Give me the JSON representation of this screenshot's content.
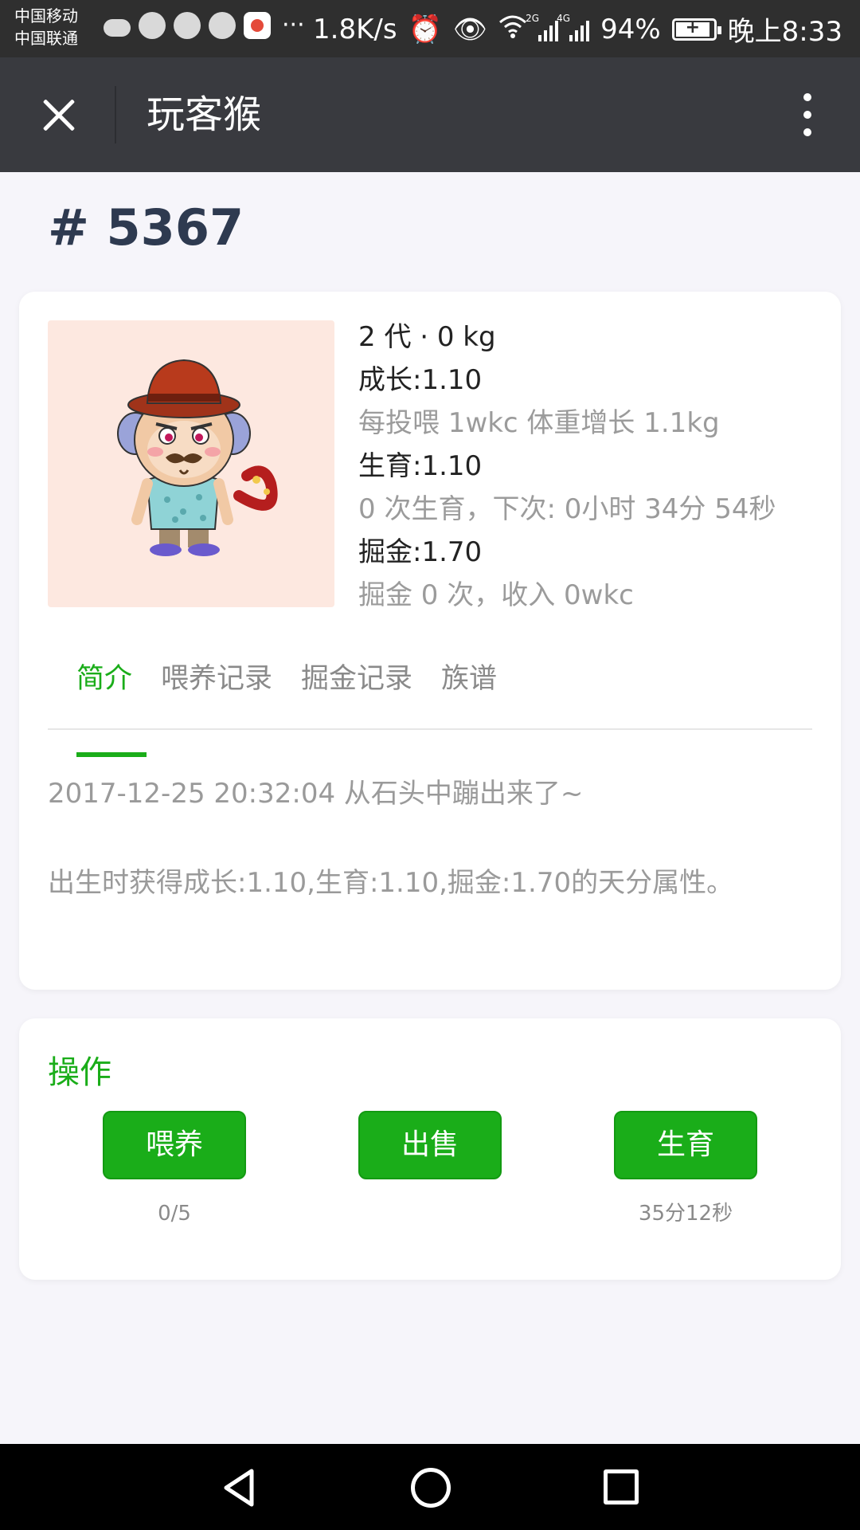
{
  "status_bar": {
    "carrier_1": "中国移动",
    "carrier_2": "中国联通",
    "more": "···",
    "speed": "1.8K/s",
    "network_1": "2G",
    "network_2": "4G",
    "battery": "94%",
    "time": "晚上8:33",
    "icons": [
      "cloud-icon",
      "chat-icon",
      "qq-icon",
      "search-app-icon",
      "map-app-icon",
      "alarm-icon",
      "eye-icon",
      "wifi-icon",
      "signal-icon",
      "battery-icon"
    ]
  },
  "title_bar": {
    "title": "玩客猴",
    "close_icon": "close-icon",
    "menu_icon": "more-vertical-icon"
  },
  "page": {
    "id": "# 5367"
  },
  "monkey": {
    "generation_weight": "2 代 · 0 kg",
    "growth": "成长:1.10",
    "growth_desc": "每投喂 1wkc 体重增长 1.1kg",
    "breed": "生育:1.10",
    "breed_desc": "0 次生育，下次: 0小时 34分 54秒",
    "mining": "掘金:1.70",
    "mining_desc": "掘金 0 次，收入 0wkc"
  },
  "tabs": [
    {
      "label": "简介",
      "active": true
    },
    {
      "label": "喂养记录",
      "active": false
    },
    {
      "label": "掘金记录",
      "active": false
    },
    {
      "label": "族谱",
      "active": false
    }
  ],
  "intro": {
    "line_1": "2017-12-25 20:32:04 从石头中蹦出来了~",
    "line_2": "出生时获得成长:1.10,生育:1.10,掘金:1.70的天分属性。"
  },
  "operations": {
    "title": "操作",
    "feed": {
      "label": "喂养",
      "sub": "0/5"
    },
    "sell": {
      "label": "出售",
      "sub": ""
    },
    "breed": {
      "label": "生育",
      "sub": "35分12秒"
    }
  },
  "colors": {
    "accent": "#1aad19",
    "title_bar": "#393a3f",
    "avatar_bg": "#fde8e0"
  }
}
